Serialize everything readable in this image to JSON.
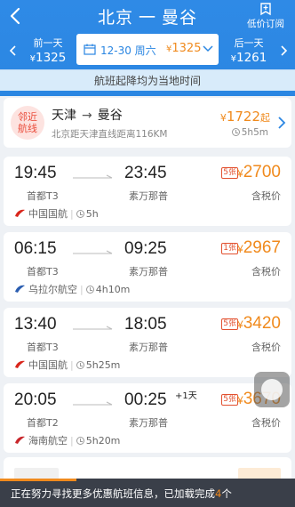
{
  "header": {
    "from": "北京",
    "dash": "一",
    "to": "曼谷",
    "price_subscribe": "低价订阅"
  },
  "date_strip": {
    "prev_label": "前一天",
    "prev_currency": "¥",
    "prev_price": "1325",
    "selected_date": "12-30 周六",
    "selected_currency": "¥",
    "selected_price": "1325",
    "next_label": "后一天",
    "next_currency": "¥",
    "next_price": "1261"
  },
  "notice": "航班起降均为当地时间",
  "nearby": {
    "badge_line1": "邻近",
    "badge_line2": "航线",
    "from": "天津",
    "arrow": "→",
    "to": "曼谷",
    "distance": "北京距天津直线距离116KM",
    "currency": "¥",
    "price": "1722",
    "suffix": "起",
    "duration": "5h5m"
  },
  "flights": [
    {
      "dep_time": "19:45",
      "dep_airport": "首都T3",
      "arr_time": "23:45",
      "arr_airport": "素万那普",
      "plus_day": "",
      "tag": "5张",
      "currency": "¥",
      "price": "2700",
      "tax": "含税价",
      "airline": "中国国航",
      "duration": "5h",
      "logo_color": "#d9261c"
    },
    {
      "dep_time": "06:15",
      "dep_airport": "首都T3",
      "arr_time": "09:25",
      "arr_airport": "素万那普",
      "plus_day": "",
      "tag": "1张",
      "currency": "¥",
      "price": "2967",
      "tax": "含税价",
      "airline": "乌拉尔航空",
      "duration": "4h10m",
      "logo_color": "#2a5db0"
    },
    {
      "dep_time": "13:40",
      "dep_airport": "首都T3",
      "arr_time": "18:05",
      "arr_airport": "素万那普",
      "plus_day": "",
      "tag": "5张",
      "currency": "¥",
      "price": "3420",
      "tax": "含税价",
      "airline": "中国国航",
      "duration": "5h25m",
      "logo_color": "#d9261c"
    },
    {
      "dep_time": "20:05",
      "dep_airport": "首都T2",
      "arr_time": "00:25",
      "arr_airport": "素万那普",
      "plus_day": "+1天",
      "tag": "5张",
      "currency": "¥",
      "price": "3670",
      "tax": "含税价",
      "airline": "海南航空",
      "duration": "5h20m",
      "logo_color": "#c8262b"
    }
  ],
  "loading": {
    "text": "正在努力寻找更多优惠航班信息，已加载完成",
    "count": "4",
    "unit": "个",
    "progress": 0.26
  },
  "colors": {
    "header_blue": "#2a86e2",
    "price_orange": "#f08a1d",
    "notice_bg": "#d8ebfa"
  }
}
